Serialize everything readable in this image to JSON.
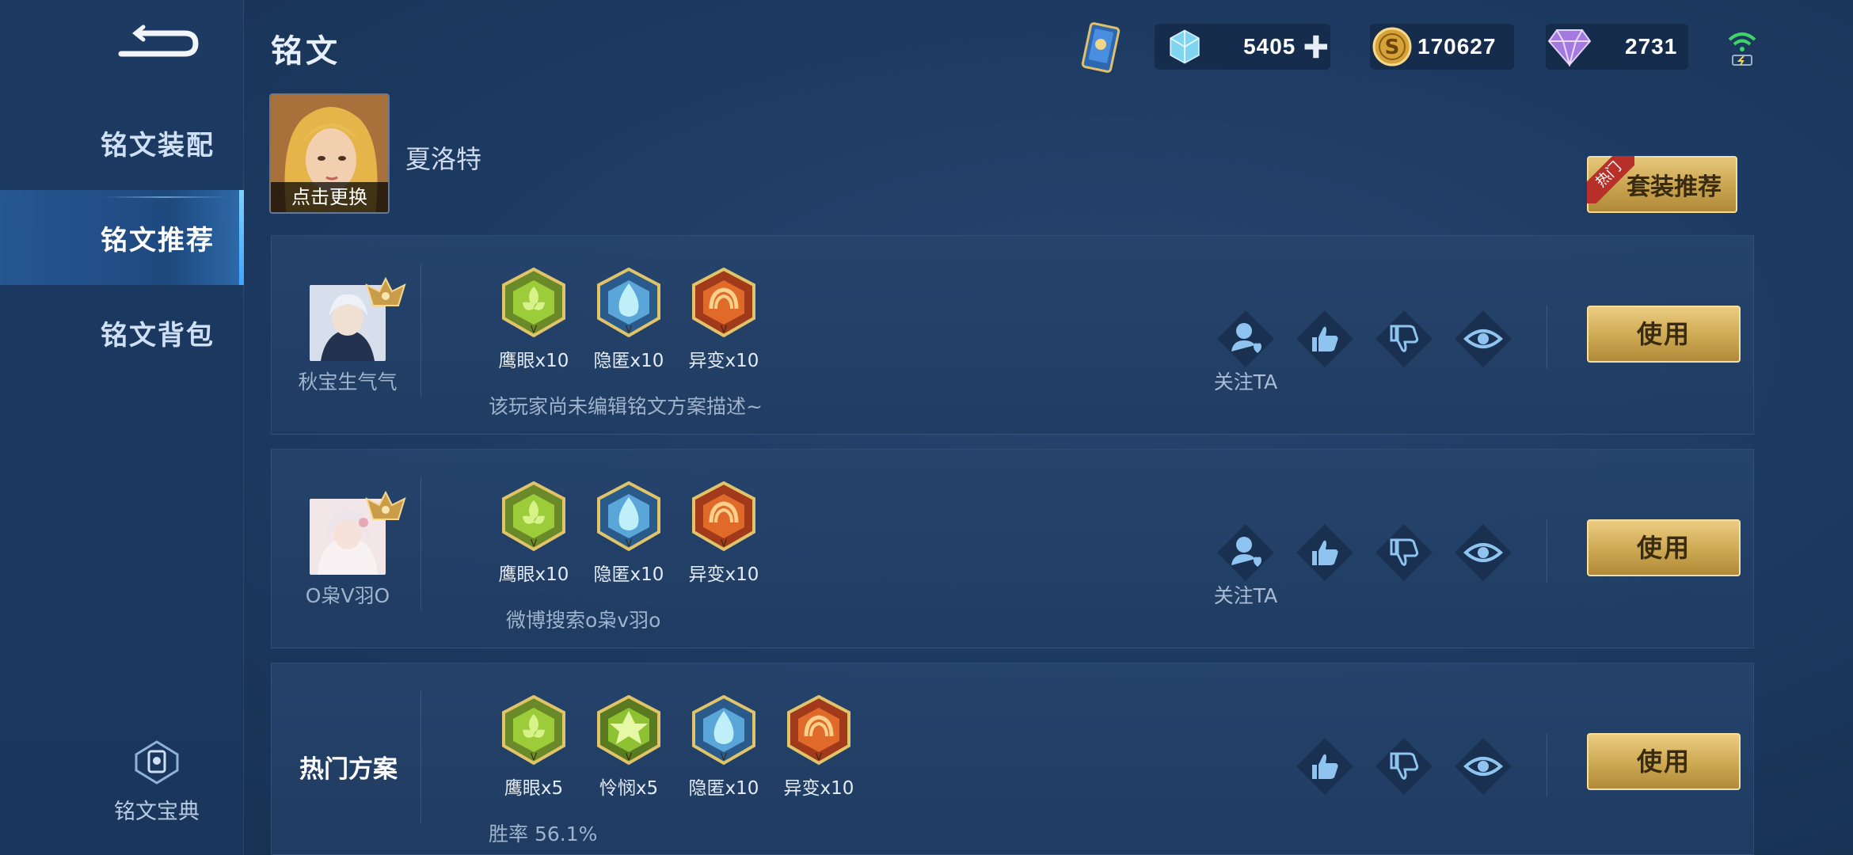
{
  "header": {
    "title": "铭文"
  },
  "currency": {
    "coupons": "5405",
    "gold": "170627",
    "diamonds": "2731"
  },
  "sidebar": {
    "items": [
      {
        "label": "铭文装配"
      },
      {
        "label": "铭文推荐"
      },
      {
        "label": "铭文背包"
      }
    ],
    "handbook_label": "铭文宝典"
  },
  "hero": {
    "name": "夏洛特",
    "change_label": "点击更换"
  },
  "suit_button": {
    "label": "套装推荐",
    "tag": "热门"
  },
  "cards": [
    {
      "author": "秋宝生气气",
      "runes": [
        {
          "label": "鹰眼x10"
        },
        {
          "label": "隐匿x10"
        },
        {
          "label": "异变x10"
        }
      ],
      "description": "该玩家尚未编辑铭文方案描述~",
      "follow_label": "关注TA",
      "use_label": "使用"
    },
    {
      "author": "O枭V羽O",
      "runes": [
        {
          "label": "鹰眼x10"
        },
        {
          "label": "隐匿x10"
        },
        {
          "label": "异变x10"
        }
      ],
      "description": "微博搜索o枭v羽o",
      "follow_label": "关注TA",
      "use_label": "使用"
    },
    {
      "title": "热门方案",
      "runes": [
        {
          "label": "鹰眼x5"
        },
        {
          "label": "怜悯x5"
        },
        {
          "label": "隐匿x10"
        },
        {
          "label": "异变x10"
        }
      ],
      "description": "胜率 56.1%",
      "use_label": "使用"
    }
  ],
  "colors": {
    "gold_button": "#cda853",
    "background": "#1d3a62",
    "accent": "#3fa6ff"
  }
}
